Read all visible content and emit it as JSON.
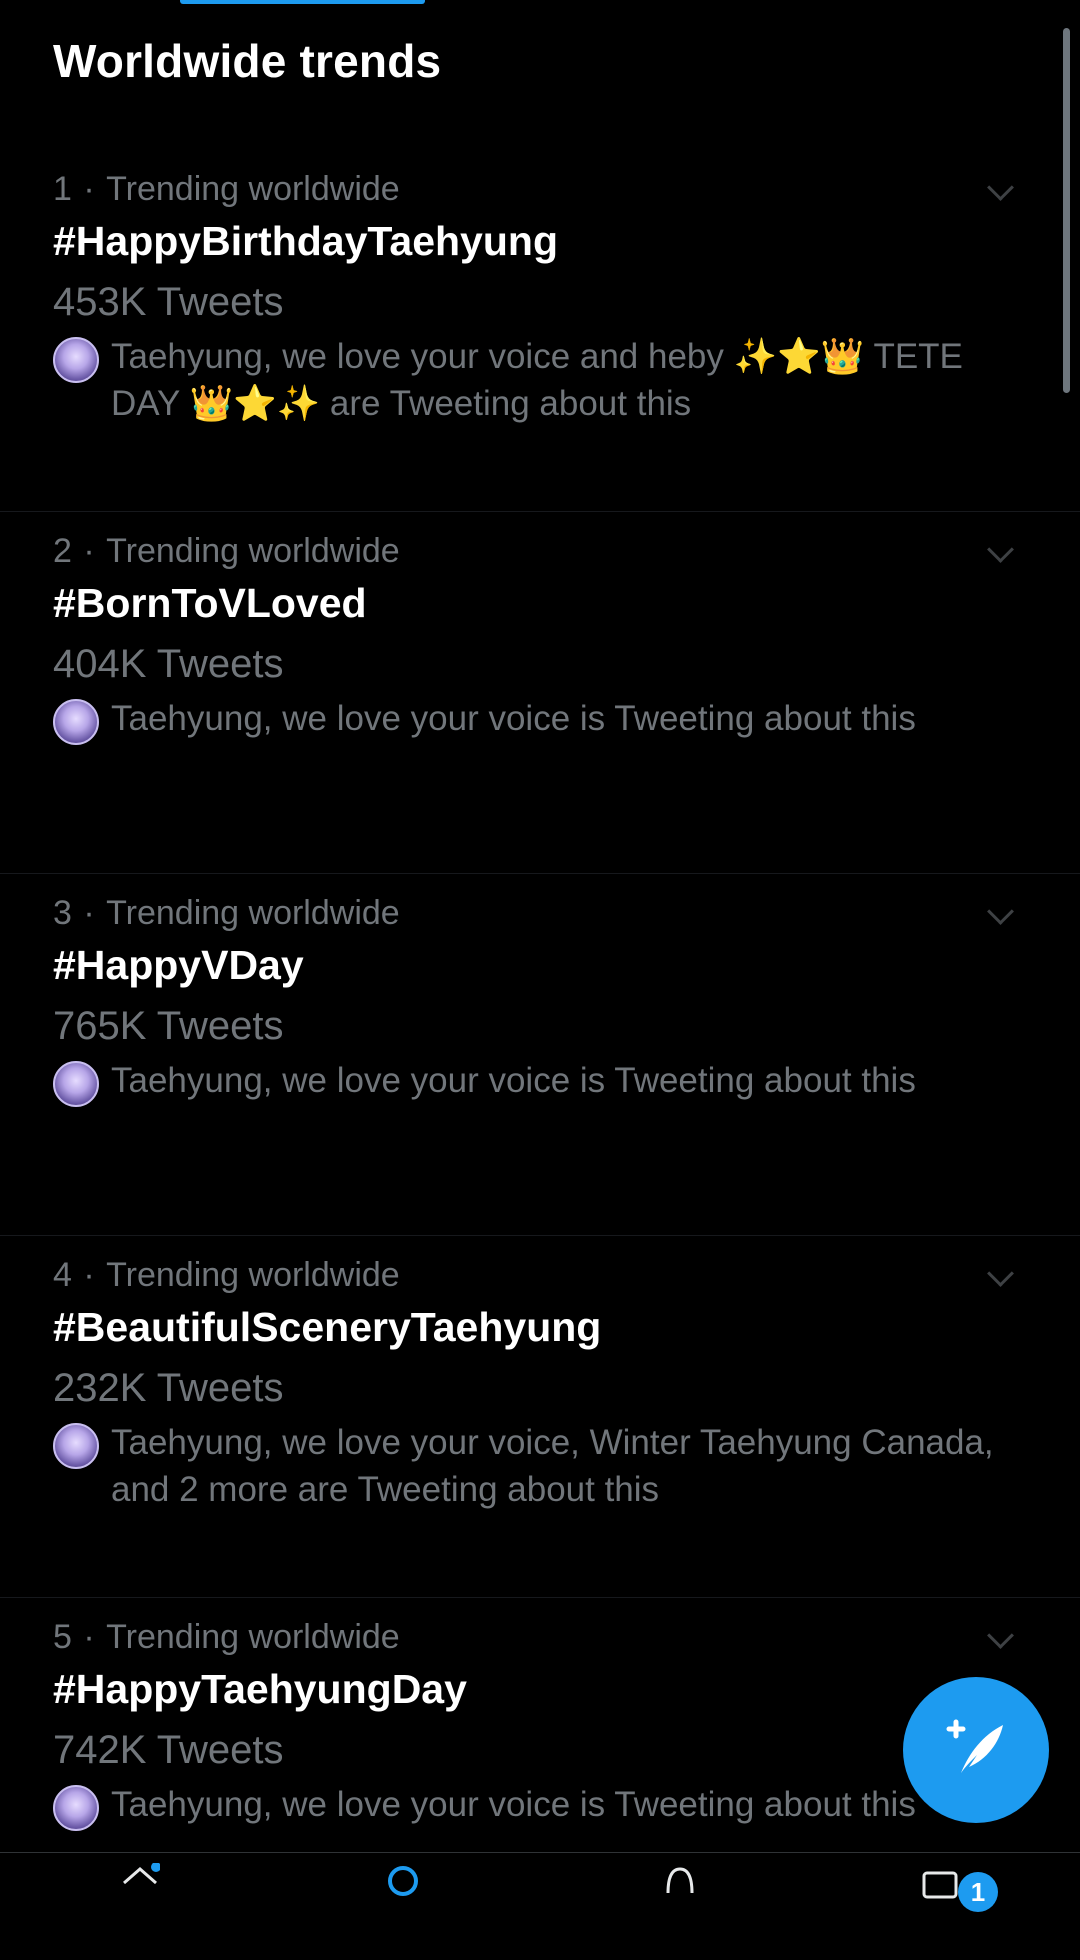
{
  "header": {
    "title": "Worldwide trends"
  },
  "trends": [
    {
      "rank": "1",
      "category": "Trending worldwide",
      "name": "#HappyBirthdayTaehyung",
      "count": "453K Tweets",
      "context": "Taehyung, we love your voice and heby ✨⭐👑 TETE DAY 👑⭐✨ are Tweeting about this"
    },
    {
      "rank": "2",
      "category": "Trending worldwide",
      "name": "#BornToVLoved",
      "count": "404K Tweets",
      "context": "Taehyung, we love your voice is Tweeting about this"
    },
    {
      "rank": "3",
      "category": "Trending worldwide",
      "name": "#HappyVDay",
      "count": "765K Tweets",
      "context": "Taehyung, we love your voice is Tweeting about this"
    },
    {
      "rank": "4",
      "category": "Trending worldwide",
      "name": "#BeautifulSceneryTaehyung",
      "count": "232K Tweets",
      "context": "Taehyung, we love your voice, Winter Taehyung Canada, and 2 more are Tweeting about this"
    },
    {
      "rank": "5",
      "category": "Trending worldwide",
      "name": "#HappyTaehyungDay",
      "count": "742K Tweets",
      "context": "Taehyung, we love your voice is Tweeting about this"
    }
  ],
  "fab": {
    "icon": "compose-tweet-icon"
  },
  "bottom_nav": {
    "tabs": [
      "home-icon",
      "search-icon",
      "notifications-icon",
      "messages-icon"
    ],
    "messages_badge": "1"
  },
  "colors": {
    "accent": "#1d9bf0",
    "background": "#000000",
    "secondary_text": "#71767b"
  }
}
